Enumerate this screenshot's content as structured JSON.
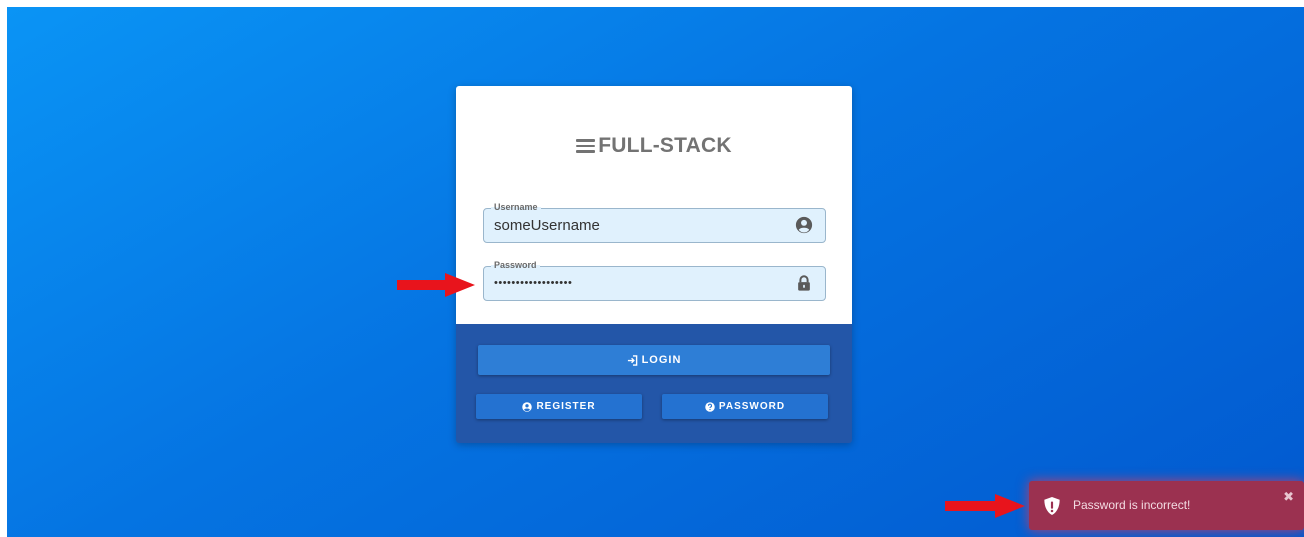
{
  "brand": {
    "title": "FULL-STACK",
    "icon": "menu-icon"
  },
  "form": {
    "username": {
      "label": "Username",
      "value": "someUsername",
      "icon": "user-circle-icon"
    },
    "password": {
      "label": "Password",
      "value": "••••••••••••••••••",
      "icon": "lock-icon"
    }
  },
  "buttons": {
    "login": {
      "label": "LOGIN",
      "icon": "sign-in-icon"
    },
    "register": {
      "label": "REGISTER",
      "icon": "user-circle-icon"
    },
    "password": {
      "label": "PASSWORD",
      "icon": "question-circle-icon"
    }
  },
  "toast": {
    "message": "Password is incorrect!",
    "icon": "shield-exclamation-icon",
    "close_icon": "close-icon",
    "close_glyph": "✖"
  },
  "colors": {
    "background_start": "#0a94f5",
    "background_end": "#0259cf",
    "card_footer": "#2356a8",
    "button": "#2e7ed6",
    "toast": "#9b3150",
    "annotation_arrow": "#e8141c"
  },
  "annotations": {
    "arrows": [
      "arrow-to-password-field",
      "arrow-to-error-toast"
    ]
  }
}
